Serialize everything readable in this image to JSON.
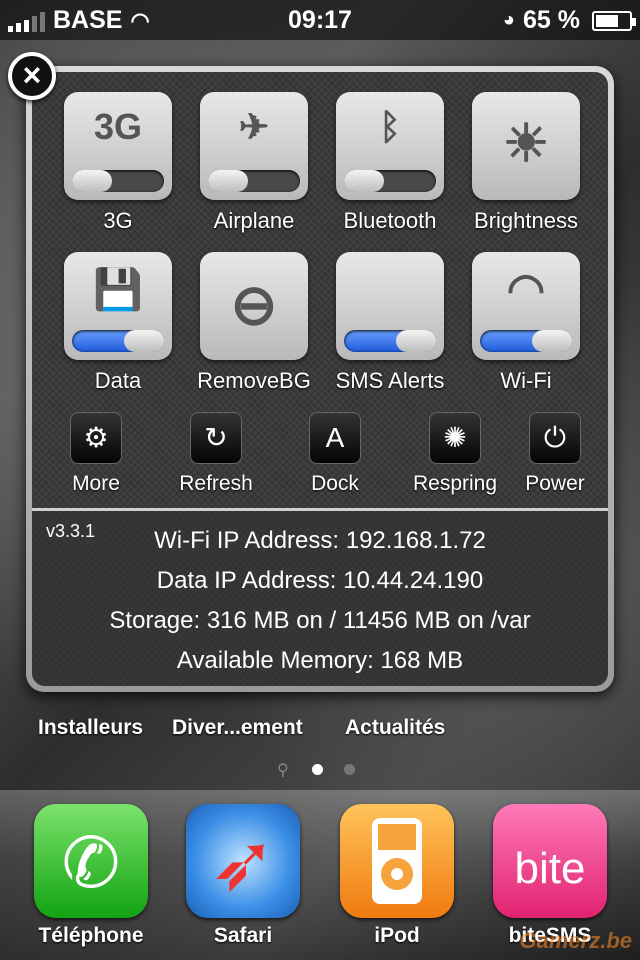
{
  "status_bar": {
    "carrier": "BASE",
    "time": "09:17",
    "battery": "65 %",
    "battery_level": 0.65
  },
  "panel": {
    "close_glyph": "×",
    "toggles": [
      {
        "label": "3G",
        "glyph": "3G",
        "icon": "3g-icon",
        "state": "off"
      },
      {
        "label": "Airplane",
        "glyph": "✈",
        "icon": "airplane-icon",
        "state": "off"
      },
      {
        "label": "Bluetooth",
        "glyph": "ᛒ",
        "icon": "bluetooth-icon",
        "state": "off"
      },
      {
        "label": "Brightness",
        "glyph": "☀",
        "icon": "brightness-icon",
        "state": "none"
      },
      {
        "label": "Data",
        "glyph": "💾",
        "icon": "floppy-disk-icon",
        "state": "on"
      },
      {
        "label": "RemoveBG",
        "glyph": "⊖",
        "icon": "minus-circle-icon",
        "state": "none"
      },
      {
        "label": "SMS Alerts",
        "glyph": "",
        "icon": "",
        "state": "on"
      },
      {
        "label": "Wi-Fi",
        "glyph": "◠",
        "icon": "wifi-icon",
        "state": "on"
      }
    ],
    "actions": [
      {
        "label": "More",
        "glyph": "⚙",
        "icon": "gear-icon"
      },
      {
        "label": "Refresh",
        "glyph": "↻",
        "icon": "refresh-icon"
      },
      {
        "label": "Dock",
        "glyph": "A",
        "icon": "app-store-icon"
      },
      {
        "label": "Respring",
        "glyph": "✺",
        "icon": "spinner-icon"
      },
      {
        "label": "Power",
        "glyph": "⏻",
        "icon": "power-icon"
      }
    ],
    "info": {
      "version": "v3.3.1",
      "lines": [
        "Wi-Fi IP Address: 192.168.1.72",
        "Data IP Address: 10.44.24.190",
        "Storage: 316 MB on / 11456 MB on /var",
        "Available Memory: 168 MB"
      ]
    }
  },
  "home": {
    "labels": [
      "Installeurs",
      "Diver...ement",
      "Actualités"
    ]
  },
  "dock": {
    "apps": [
      {
        "label": "Téléphone",
        "icon": "phone-icon",
        "color": "#2fbf2f"
      },
      {
        "label": "Safari",
        "icon": "compass-icon",
        "color": "#3a8ee6"
      },
      {
        "label": "iPod",
        "icon": "ipod-icon",
        "color": "#f08a1a"
      },
      {
        "label": "biteSMS",
        "icon": "bitesms-icon",
        "color": "#e6338a",
        "glyph": "bite"
      }
    ]
  },
  "watermark": "Gamerz.be",
  "colors": {
    "toggle_on": "#1e5ad8",
    "panel_border": "#cfcfcf"
  }
}
